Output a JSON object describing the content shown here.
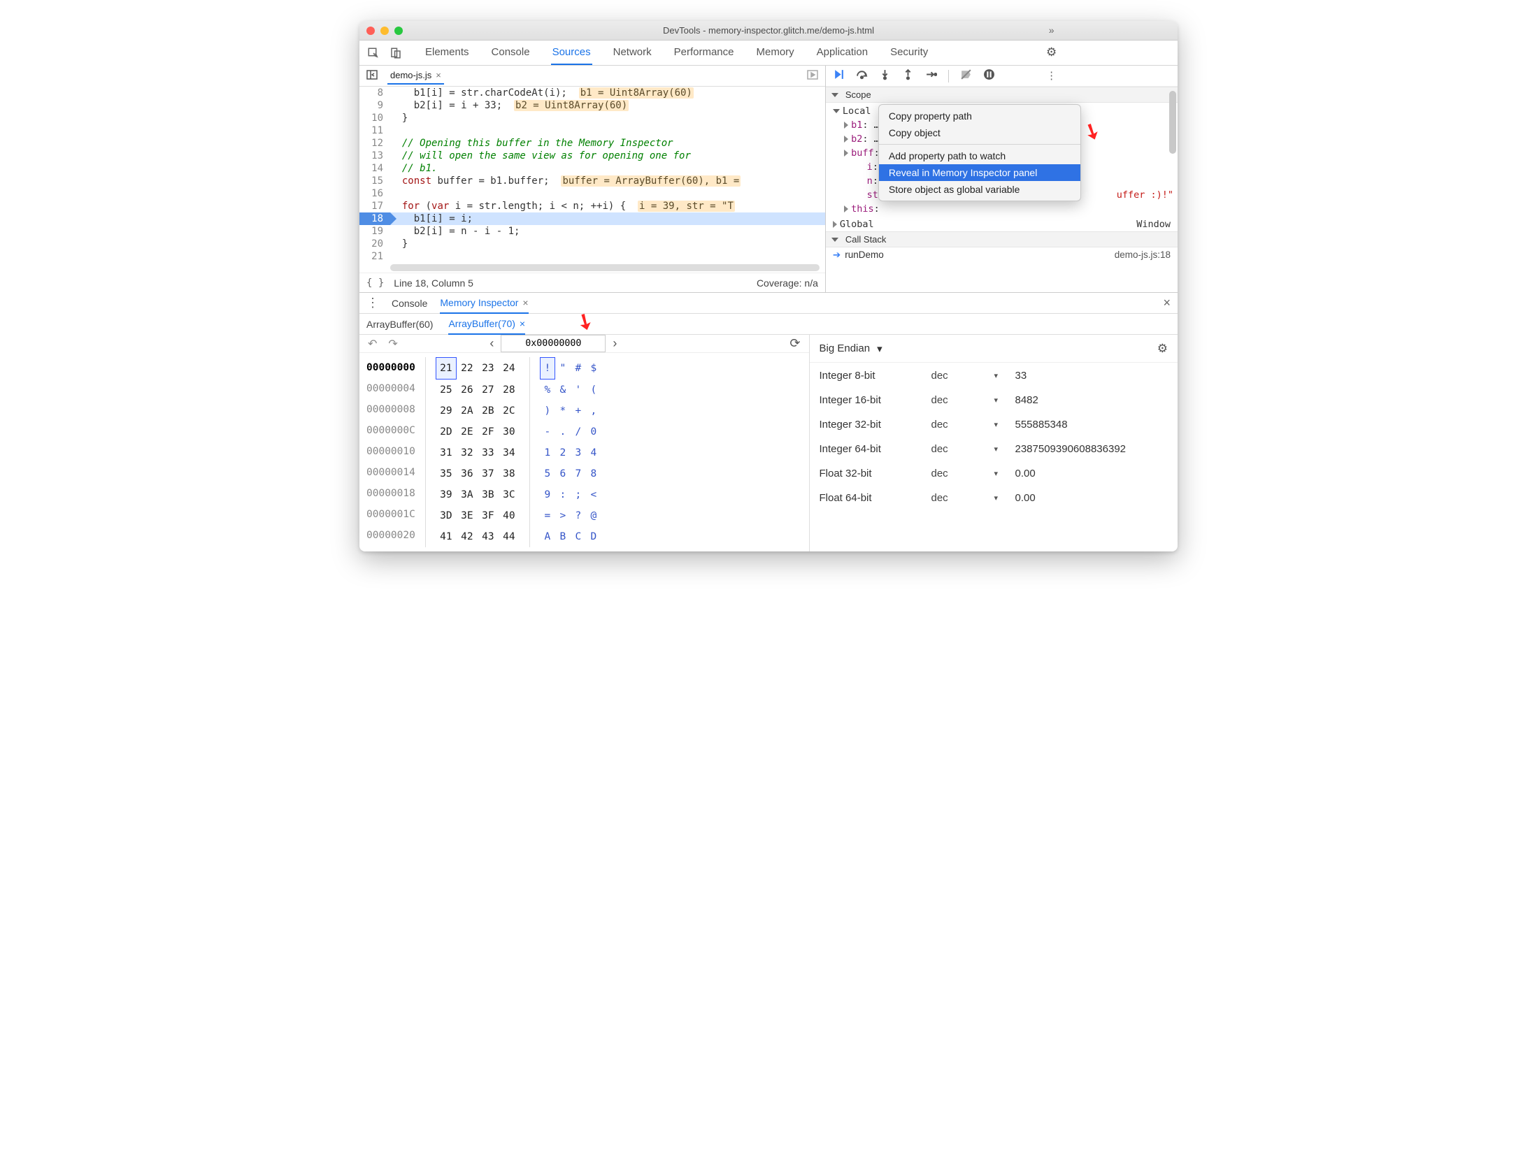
{
  "window": {
    "title": "DevTools - memory-inspector.glitch.me/demo-js.html"
  },
  "tabs": {
    "items": [
      "Elements",
      "Console",
      "Sources",
      "Network",
      "Performance",
      "Memory",
      "Application",
      "Security"
    ],
    "active": "Sources",
    "more": "»"
  },
  "file_tab": {
    "name": "demo-js.js"
  },
  "code": {
    "lines": [
      {
        "n": "8",
        "html": "    b1[i] = str.charCodeAt(i);  <span class='cm-badge'>b1 = Uint8Array(60)</span>"
      },
      {
        "n": "9",
        "html": "    b2[i] = i + 33;  <span class='cm-badge'>b2 = Uint8Array(60)</span>"
      },
      {
        "n": "10",
        "html": "  }"
      },
      {
        "n": "11",
        "html": " "
      },
      {
        "n": "12",
        "html": "  <span class='cm-comment'>// Opening this buffer in the Memory Inspector</span>"
      },
      {
        "n": "13",
        "html": "  <span class='cm-comment'>// will open the same view as for opening one for</span>"
      },
      {
        "n": "14",
        "html": "  <span class='cm-comment'>// b1.</span>"
      },
      {
        "n": "15",
        "html": "  <span class='cm-kw'>const</span> buffer = b1.buffer;  <span class='cm-badge'>buffer = ArrayBuffer(60), b1 =</span>"
      },
      {
        "n": "16",
        "html": " "
      },
      {
        "n": "17",
        "html": "  <span class='cm-kw'>for</span> (<span class='cm-kw'>var</span> i = str.length; i < n; ++i) {  <span class='cm-badge'>i = 39, str = \"T</span>"
      },
      {
        "n": "18",
        "html": "    b1[i] = i;",
        "hl": true
      },
      {
        "n": "19",
        "html": "    b2[i] = n - i - 1;"
      },
      {
        "n": "20",
        "html": "  }"
      },
      {
        "n": "21",
        "html": " "
      }
    ]
  },
  "statusbar": {
    "pos": "Line 18, Column 5",
    "coverage": "Coverage: n/a"
  },
  "scope": {
    "title": "Scope",
    "local": "Local",
    "entries": [
      {
        "k": "b1",
        "v": "…"
      },
      {
        "k": "b2",
        "v": "…"
      },
      {
        "k": "buff",
        "v": ""
      },
      {
        "k": "i",
        "v": "",
        "indent": true,
        "notri": true
      },
      {
        "k": "n",
        "v": "(",
        "indent": true,
        "notri": true
      },
      {
        "k": "str",
        "v": "",
        "indent": true,
        "notri": true,
        "tail": "uffer :)!\"",
        "tailclass": "str"
      },
      {
        "k": "this",
        "v": "",
        "indent": false
      }
    ],
    "global_label": "Global",
    "global_val": "Window"
  },
  "callstack": {
    "title": "Call Stack",
    "fn": "runDemo",
    "loc": "demo-js.js:18"
  },
  "context_menu": {
    "items": [
      "Copy property path",
      "Copy object",
      "-",
      "Add property path to watch",
      "Reveal in Memory Inspector panel",
      "Store object as global variable"
    ],
    "selected": "Reveal in Memory Inspector panel"
  },
  "drawer": {
    "tabs": [
      "Console",
      "Memory Inspector"
    ],
    "active": "Memory Inspector"
  },
  "buffers": {
    "tabs": [
      "ArrayBuffer(60)",
      "ArrayBuffer(70)"
    ],
    "active": "ArrayBuffer(70)"
  },
  "memnav": {
    "address": "0x00000000"
  },
  "hex": {
    "rows": [
      {
        "addr": "00000000",
        "first": true,
        "bytes": [
          "21",
          "22",
          "23",
          "24"
        ],
        "ascii": [
          "!",
          "\"",
          "#",
          "$"
        ],
        "sel0": true
      },
      {
        "addr": "00000004",
        "bytes": [
          "25",
          "26",
          "27",
          "28"
        ],
        "ascii": [
          "%",
          "&",
          "'",
          "("
        ]
      },
      {
        "addr": "00000008",
        "bytes": [
          "29",
          "2A",
          "2B",
          "2C"
        ],
        "ascii": [
          ")",
          "*",
          "+",
          ","
        ]
      },
      {
        "addr": "0000000C",
        "bytes": [
          "2D",
          "2E",
          "2F",
          "30"
        ],
        "ascii": [
          "-",
          ".",
          "/",
          "0"
        ]
      },
      {
        "addr": "00000010",
        "bytes": [
          "31",
          "32",
          "33",
          "34"
        ],
        "ascii": [
          "1",
          "2",
          "3",
          "4"
        ]
      },
      {
        "addr": "00000014",
        "bytes": [
          "35",
          "36",
          "37",
          "38"
        ],
        "ascii": [
          "5",
          "6",
          "7",
          "8"
        ]
      },
      {
        "addr": "00000018",
        "bytes": [
          "39",
          "3A",
          "3B",
          "3C"
        ],
        "ascii": [
          "9",
          ":",
          ";",
          "<"
        ]
      },
      {
        "addr": "0000001C",
        "bytes": [
          "3D",
          "3E",
          "3F",
          "40"
        ],
        "ascii": [
          "=",
          ">",
          "?",
          "@"
        ]
      },
      {
        "addr": "00000020",
        "bytes": [
          "41",
          "42",
          "43",
          "44"
        ],
        "ascii": [
          "A",
          "B",
          "C",
          "D"
        ]
      }
    ]
  },
  "interp": {
    "endian": "Big Endian",
    "rows": [
      {
        "label": "Integer 8-bit",
        "fmt": "dec",
        "val": "33"
      },
      {
        "label": "Integer 16-bit",
        "fmt": "dec",
        "val": "8482"
      },
      {
        "label": "Integer 32-bit",
        "fmt": "dec",
        "val": "555885348"
      },
      {
        "label": "Integer 64-bit",
        "fmt": "dec",
        "val": "2387509390608836392"
      },
      {
        "label": "Float 32-bit",
        "fmt": "dec",
        "val": "0.00"
      },
      {
        "label": "Float 64-bit",
        "fmt": "dec",
        "val": "0.00"
      }
    ]
  }
}
